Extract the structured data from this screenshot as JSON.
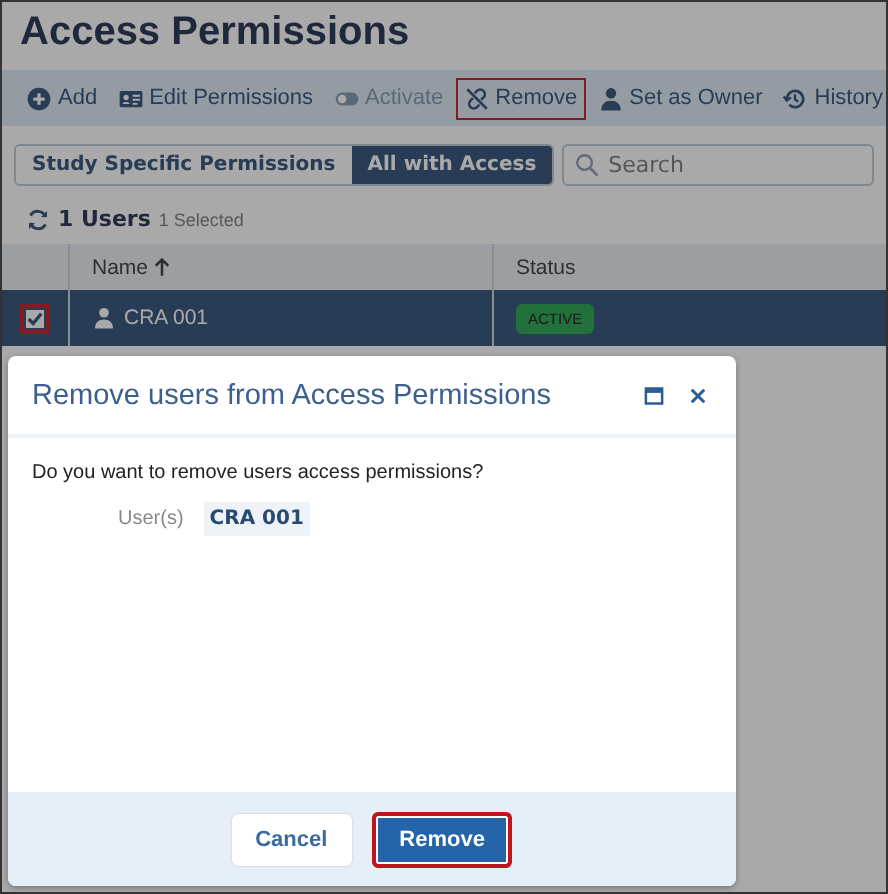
{
  "page": {
    "title": "Access Permissions"
  },
  "toolbar": [
    {
      "kind": "add",
      "label": "Add",
      "disabled": false,
      "highlighted": false
    },
    {
      "kind": "edit",
      "label": "Edit Permissions",
      "disabled": false,
      "highlighted": false
    },
    {
      "kind": "activate",
      "label": "Activate",
      "disabled": true,
      "highlighted": false
    },
    {
      "kind": "remove",
      "label": "Remove",
      "disabled": false,
      "highlighted": true
    },
    {
      "kind": "owner",
      "label": "Set as Owner",
      "disabled": false,
      "highlighted": false
    },
    {
      "kind": "history",
      "label": "History",
      "disabled": false,
      "highlighted": false
    }
  ],
  "tabs": [
    {
      "label": "Study Specific Permissions",
      "selected": false
    },
    {
      "label": "All with Access",
      "selected": true
    }
  ],
  "search": {
    "placeholder": "Search"
  },
  "summary": {
    "count": "1 Users",
    "selected": "1 Selected"
  },
  "table": {
    "columns": [
      {
        "label": "Name",
        "sorted_ascending": true
      },
      {
        "label": "Status",
        "sorted_ascending": false
      }
    ],
    "rows": [
      {
        "name": "CRA 001",
        "status": "ACTIVE",
        "selected": true,
        "checked": true,
        "highlighted": true
      }
    ]
  },
  "dialog": {
    "title": "Remove users from Access Permissions",
    "message": "Do you want to remove users access permissions?",
    "field_label": "User(s)",
    "field_value": "CRA 001",
    "buttons": [
      {
        "label": "Cancel",
        "kind": "secondary",
        "highlighted": false
      },
      {
        "label": "Remove",
        "kind": "primary",
        "highlighted": true
      }
    ]
  }
}
